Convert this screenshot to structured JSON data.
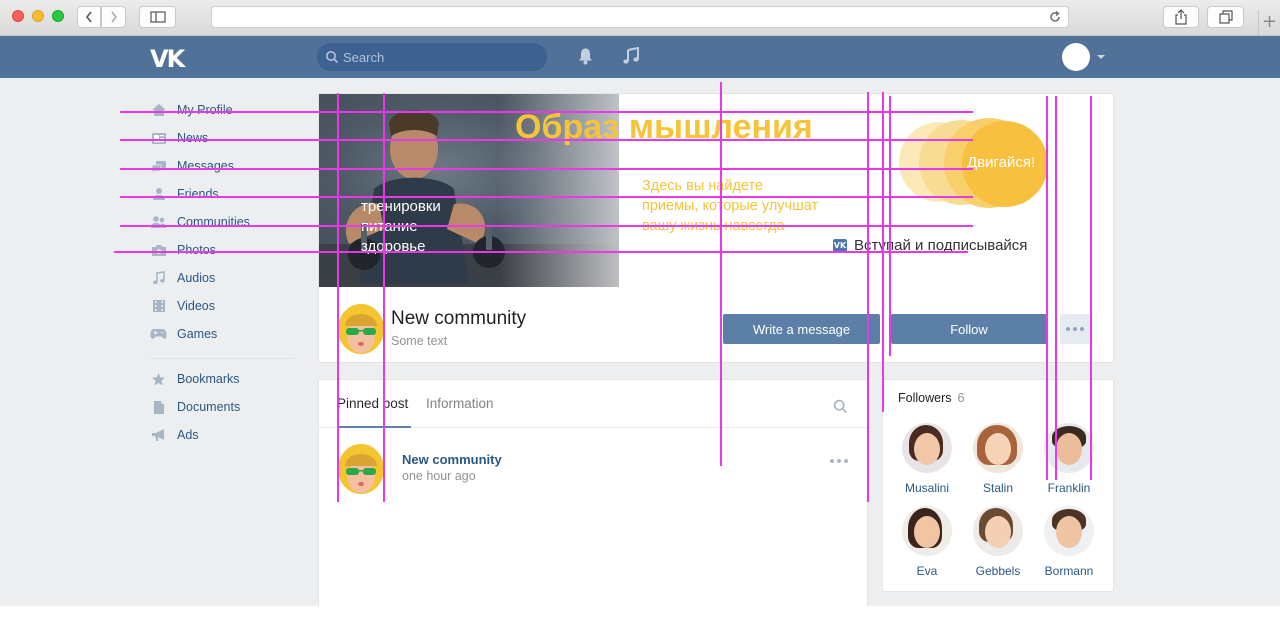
{
  "browser": {
    "traffic_lights": [
      "close",
      "minimize",
      "zoom"
    ],
    "new_tab_label": "+"
  },
  "header": {
    "logo": "VK",
    "search_placeholder": "Search"
  },
  "nav": {
    "items": [
      {
        "label": "My Profile",
        "icon": "house-icon"
      },
      {
        "label": "News",
        "icon": "news-icon"
      },
      {
        "label": "Messages",
        "icon": "messages-icon"
      },
      {
        "label": "Friends",
        "icon": "person-icon"
      },
      {
        "label": "Communities",
        "icon": "people-icon"
      },
      {
        "label": "Photos",
        "icon": "camera-icon"
      },
      {
        "label": "Audios",
        "icon": "music-note-icon"
      },
      {
        "label": "Videos",
        "icon": "film-icon"
      },
      {
        "label": "Games",
        "icon": "gamepad-icon"
      }
    ],
    "secondary": [
      {
        "label": "Bookmarks",
        "icon": "star-icon"
      },
      {
        "label": "Documents",
        "icon": "document-icon"
      },
      {
        "label": "Ads",
        "icon": "megaphone-icon"
      }
    ]
  },
  "cover": {
    "title": "Образ мышления",
    "left_lines": [
      "тренировки",
      "питание",
      "здоровье"
    ],
    "right_text": "Здесь вы найдете приемы, которые улучшат вашу жизнь навсегда",
    "cta": "Двигайся!",
    "join": "Вступай и подписывайся",
    "vk_badge": "VK",
    "accent": "#f5c43a"
  },
  "community": {
    "name": "New community",
    "subtitle": "Some text",
    "write_button": "Write a message",
    "follow_button": "Follow"
  },
  "tabs": [
    {
      "label": "Pinned post"
    },
    {
      "label": "Information"
    }
  ],
  "post": {
    "author": "New community",
    "time": "one hour ago"
  },
  "followers": {
    "title": "Followers",
    "count": "6",
    "people": [
      {
        "name": "Musalini"
      },
      {
        "name": "Stalin"
      },
      {
        "name": "Franklin"
      },
      {
        "name": "Eva"
      },
      {
        "name": "Gebbels"
      },
      {
        "name": "Bormann"
      }
    ]
  },
  "colors": {
    "header": "#507299",
    "link": "#2a5885",
    "button": "#5b7fa6",
    "overlay_lines": "#e838e8"
  }
}
